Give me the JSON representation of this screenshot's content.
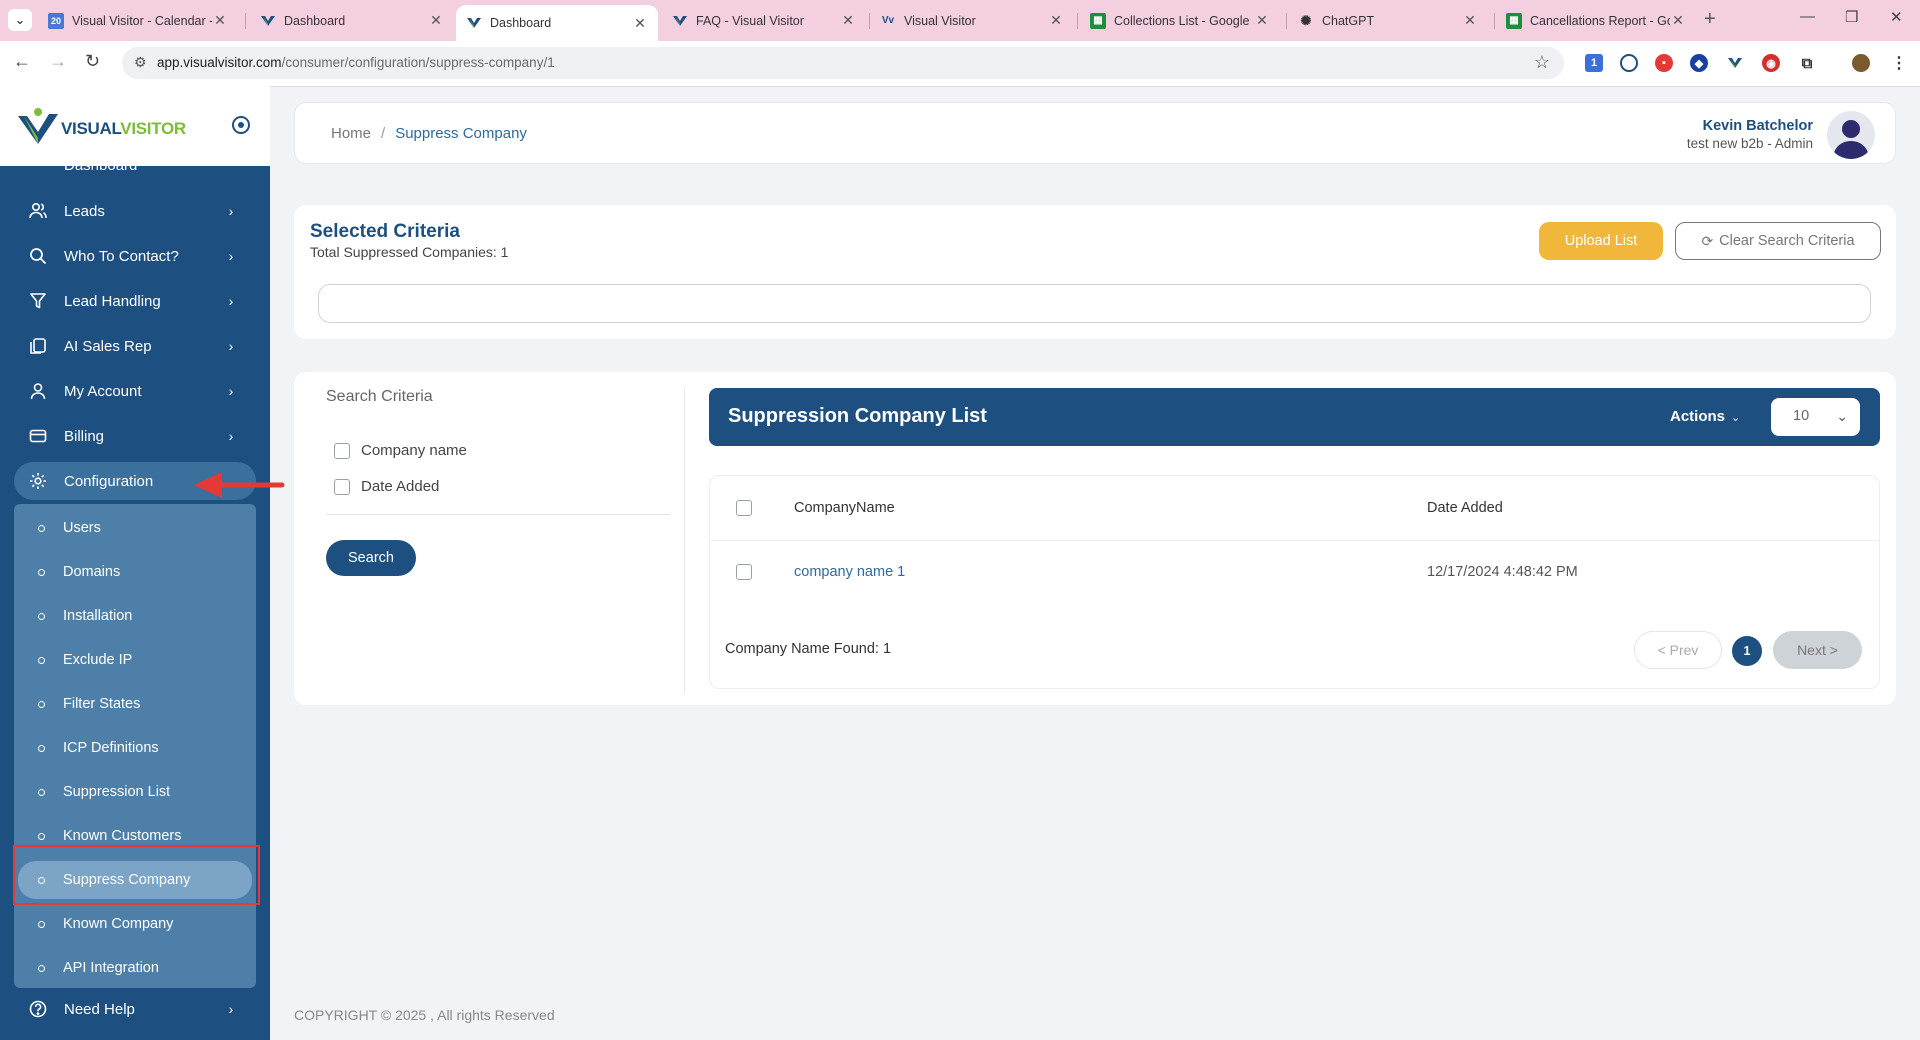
{
  "browser": {
    "tabs": [
      {
        "title": "Visual Visitor - Calendar -",
        "icon": "calendar-icon",
        "active": false
      },
      {
        "title": "Dashboard",
        "icon": "visualvisitor-icon",
        "active": false
      },
      {
        "title": "Dashboard",
        "icon": "visualvisitor-icon",
        "active": true
      },
      {
        "title": "FAQ - Visual Visitor",
        "icon": "visualvisitor-icon",
        "active": false
      },
      {
        "title": "Visual Visitor",
        "icon": "visualvisitor-icon",
        "active": false
      },
      {
        "title": "Collections List - Google S",
        "icon": "sheets-icon",
        "active": false
      },
      {
        "title": "ChatGPT",
        "icon": "chatgpt-icon",
        "active": false
      },
      {
        "title": "Cancellations Report - Go",
        "icon": "sheets-icon",
        "active": false
      }
    ],
    "url_host": "app.visualvisitor.com",
    "url_path": "/consumer/configuration/suppress-company/1",
    "ext_badge": "1"
  },
  "sidebar": {
    "logo_part1": "VISUAL",
    "logo_part2": "VISITOR",
    "partial_item": "Dashboard",
    "items": [
      {
        "label": "Leads",
        "icon": "users-icon"
      },
      {
        "label": "Who To Contact?",
        "icon": "search-icon"
      },
      {
        "label": "Lead Handling",
        "icon": "filter-icon"
      },
      {
        "label": "AI Sales Rep",
        "icon": "copy-icon"
      },
      {
        "label": "My Account",
        "icon": "user-icon"
      },
      {
        "label": "Billing",
        "icon": "card-icon"
      }
    ],
    "config_label": "Configuration",
    "submenu": [
      "Users",
      "Domains",
      "Installation",
      "Exclude IP",
      "Filter States",
      "ICP Definitions",
      "Suppression List",
      "Known Customers",
      "Suppress Company",
      "Known Company",
      "API Integration"
    ],
    "active_sub": "Suppress Company",
    "help_label": "Need Help"
  },
  "header": {
    "crumb_home": "Home",
    "crumb_sep": "/",
    "crumb_current": "Suppress Company",
    "user_name": "Kevin Batchelor",
    "user_role": "test new b2b - Admin"
  },
  "criteria": {
    "title": "Selected Criteria",
    "subtitle": "Total Suppressed Companies: 1",
    "upload_label": "Upload List",
    "clear_label": "Clear Search Criteria"
  },
  "search": {
    "title": "Search Criteria",
    "options": [
      "Company name",
      "Date Added"
    ],
    "button": "Search"
  },
  "list": {
    "title": "Suppression Company List",
    "actions_label": "Actions",
    "page_size": "10",
    "columns": [
      "CompanyName",
      "Date Added"
    ],
    "rows": [
      {
        "company": "company name 1",
        "date": "12/17/2024 4:48:42 PM"
      }
    ],
    "found": "Company Name Found: 1",
    "prev": "< Prev",
    "page": "1",
    "next": "Next >"
  },
  "footer": "COPYRIGHT © 2025 , All rights Reserved",
  "colors": {
    "sidebar": "#1d5080",
    "accent_yellow": "#f0b73a",
    "highlight_red": "#e53935"
  }
}
